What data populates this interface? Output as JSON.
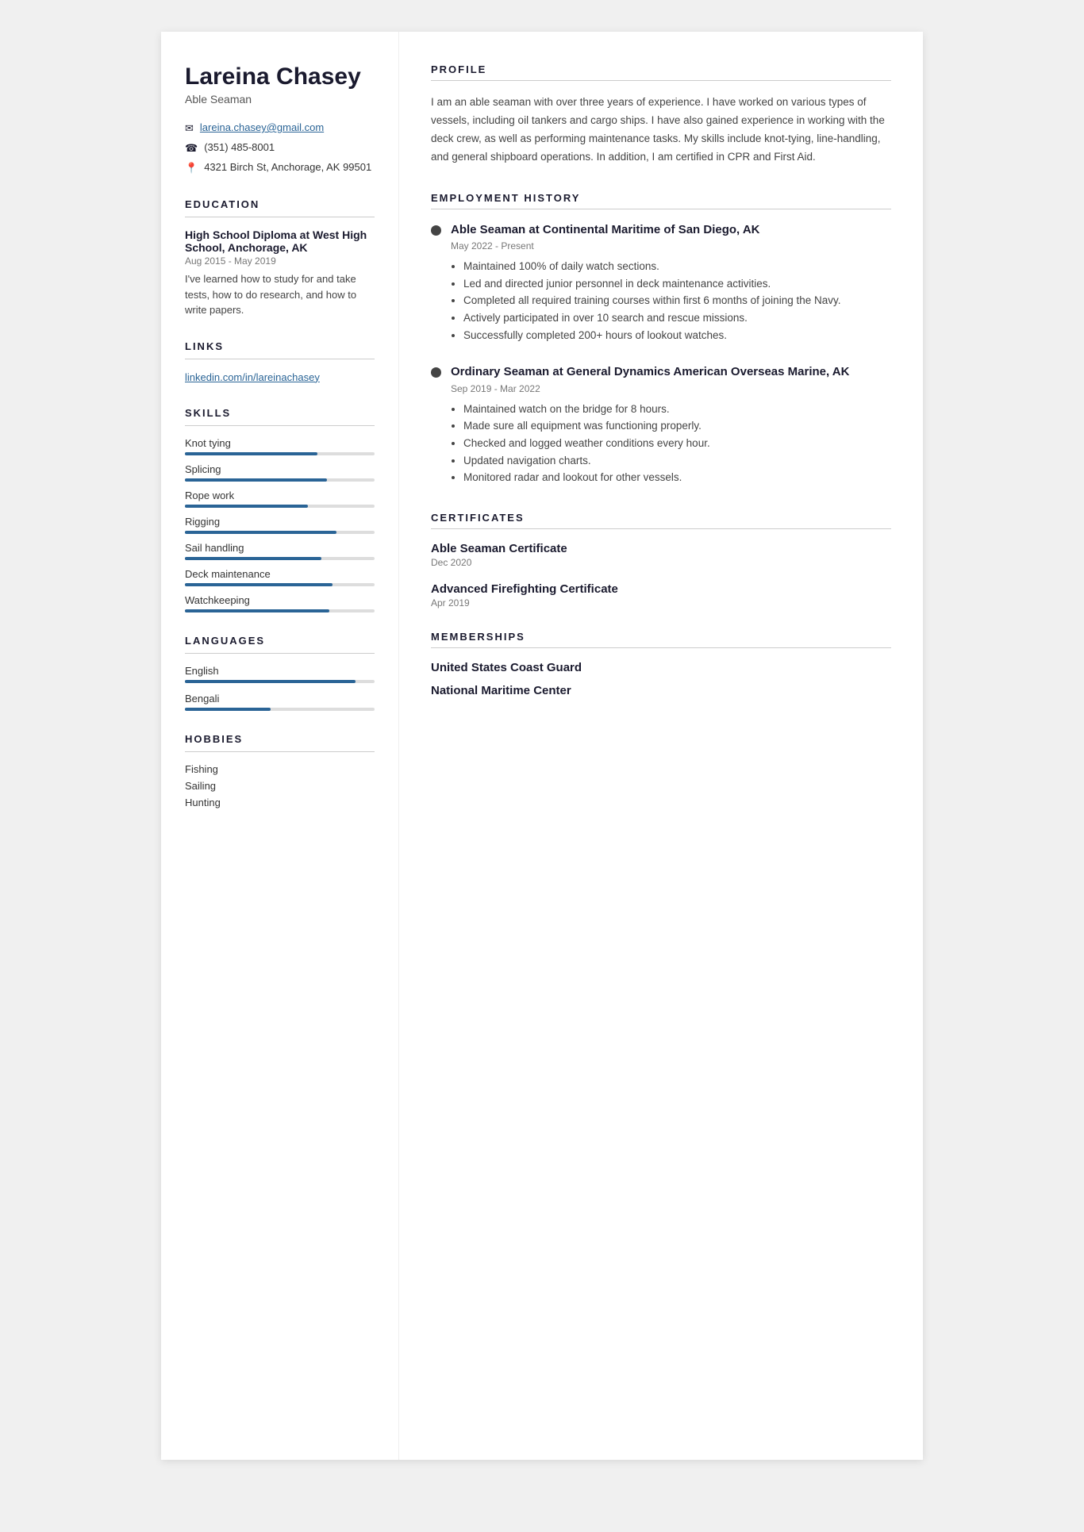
{
  "left": {
    "name": "Lareina Chasey",
    "subtitle": "Able Seaman",
    "contact": {
      "email": "lareina.chasey@gmail.com",
      "phone": "(351) 485-8001",
      "address": "4321 Birch St, Anchorage, AK 99501"
    },
    "education_title": "EDUCATION",
    "education": {
      "degree": "High School Diploma at West High School, Anchorage, AK",
      "dates": "Aug 2015 - May 2019",
      "description": "I've learned how to study for and take tests, how to do research, and how to write papers."
    },
    "links_title": "LINKS",
    "links": [
      {
        "label": "linkedin.com/in/lareinachasey",
        "url": "#"
      }
    ],
    "skills_title": "SKILLS",
    "skills": [
      {
        "name": "Knot tying",
        "level": 70
      },
      {
        "name": "Splicing",
        "level": 75
      },
      {
        "name": "Rope work",
        "level": 65
      },
      {
        "name": "Rigging",
        "level": 80
      },
      {
        "name": "Sail handling",
        "level": 72
      },
      {
        "name": "Deck maintenance",
        "level": 78
      },
      {
        "name": "Watchkeeping",
        "level": 76
      }
    ],
    "languages_title": "LANGUAGES",
    "languages": [
      {
        "name": "English",
        "level": 90
      },
      {
        "name": "Bengali",
        "level": 45
      }
    ],
    "hobbies_title": "HOBBIES",
    "hobbies": [
      "Fishing",
      "Sailing",
      "Hunting"
    ]
  },
  "right": {
    "profile_title": "PROFILE",
    "profile_text": "I am an able seaman with over three years of experience. I have worked on various types of vessels, including oil tankers and cargo ships. I have also gained experience in working with the deck crew, as well as performing maintenance tasks. My skills include knot-tying, line-handling, and general shipboard operations. In addition, I am certified in CPR and First Aid.",
    "employment_title": "EMPLOYMENT HISTORY",
    "jobs": [
      {
        "title": "Able Seaman at Continental Maritime of San Diego, AK",
        "dates": "May 2022 - Present",
        "bullets": [
          "Maintained 100% of daily watch sections.",
          "Led and directed junior personnel in deck maintenance activities.",
          "Completed all required training courses within first 6 months of joining the Navy.",
          "Actively participated in over 10 search and rescue missions.",
          "Successfully completed 200+ hours of lookout watches."
        ]
      },
      {
        "title": "Ordinary Seaman at General Dynamics American Overseas Marine, AK",
        "dates": "Sep 2019 - Mar 2022",
        "bullets": [
          "Maintained watch on the bridge for 8 hours.",
          "Made sure all equipment was functioning properly.",
          "Checked and logged weather conditions every hour.",
          "Updated navigation charts.",
          "Monitored radar and lookout for other vessels."
        ]
      }
    ],
    "certificates_title": "CERTIFICATES",
    "certificates": [
      {
        "title": "Able Seaman Certificate",
        "date": "Dec 2020"
      },
      {
        "title": "Advanced Firefighting Certificate",
        "date": "Apr 2019"
      }
    ],
    "memberships_title": "MEMBERSHIPS",
    "memberships": [
      {
        "name": "United States Coast Guard"
      },
      {
        "name": "National Maritime Center"
      }
    ]
  }
}
